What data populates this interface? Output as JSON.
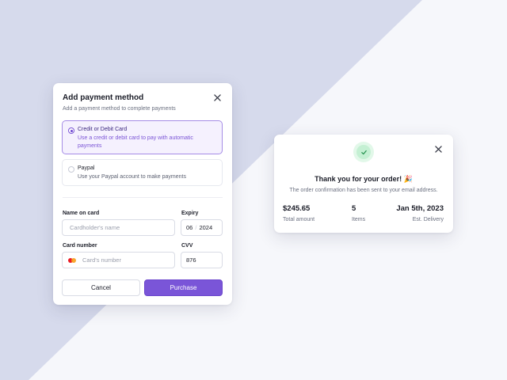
{
  "payment_modal": {
    "title": "Add payment method",
    "subtitle": "Add a payment method to complete payments",
    "close_icon": "close-icon",
    "options": [
      {
        "title": "Credit or Debit Card",
        "description": "Use a credit or debit card to pay with automatic payments",
        "selected": true
      },
      {
        "title": "Paypal",
        "description": "Use your Paypal account to make payments",
        "selected": false
      }
    ],
    "fields": {
      "name_label": "Name on card",
      "name_placeholder": "Cardholder's name",
      "name_value": "",
      "expiry_label": "Expiry",
      "expiry_month": "06",
      "expiry_year": "2024",
      "card_label": "Card number",
      "card_placeholder": "Card's number",
      "card_value": "",
      "card_icon": "mastercard-icon",
      "cvv_label": "CVV",
      "cvv_value": "876"
    },
    "buttons": {
      "cancel": "Cancel",
      "purchase": "Purchase"
    }
  },
  "confirmation": {
    "check_icon": "check-icon",
    "close_icon": "close-icon",
    "title": "Thank you for your order! 🎉",
    "subtitle": "The order confirmation has been sent to your email address.",
    "stats": [
      {
        "value": "$245.65",
        "label": "Total amount"
      },
      {
        "value": "5",
        "label": "Items"
      },
      {
        "value": "Jan 5th, 2023",
        "label": "Est. Delivery"
      }
    ]
  },
  "colors": {
    "accent": "#7a55d8",
    "background": "#f6f7fb",
    "background_shape": "#d6daec",
    "success": "#c4f0d3"
  }
}
